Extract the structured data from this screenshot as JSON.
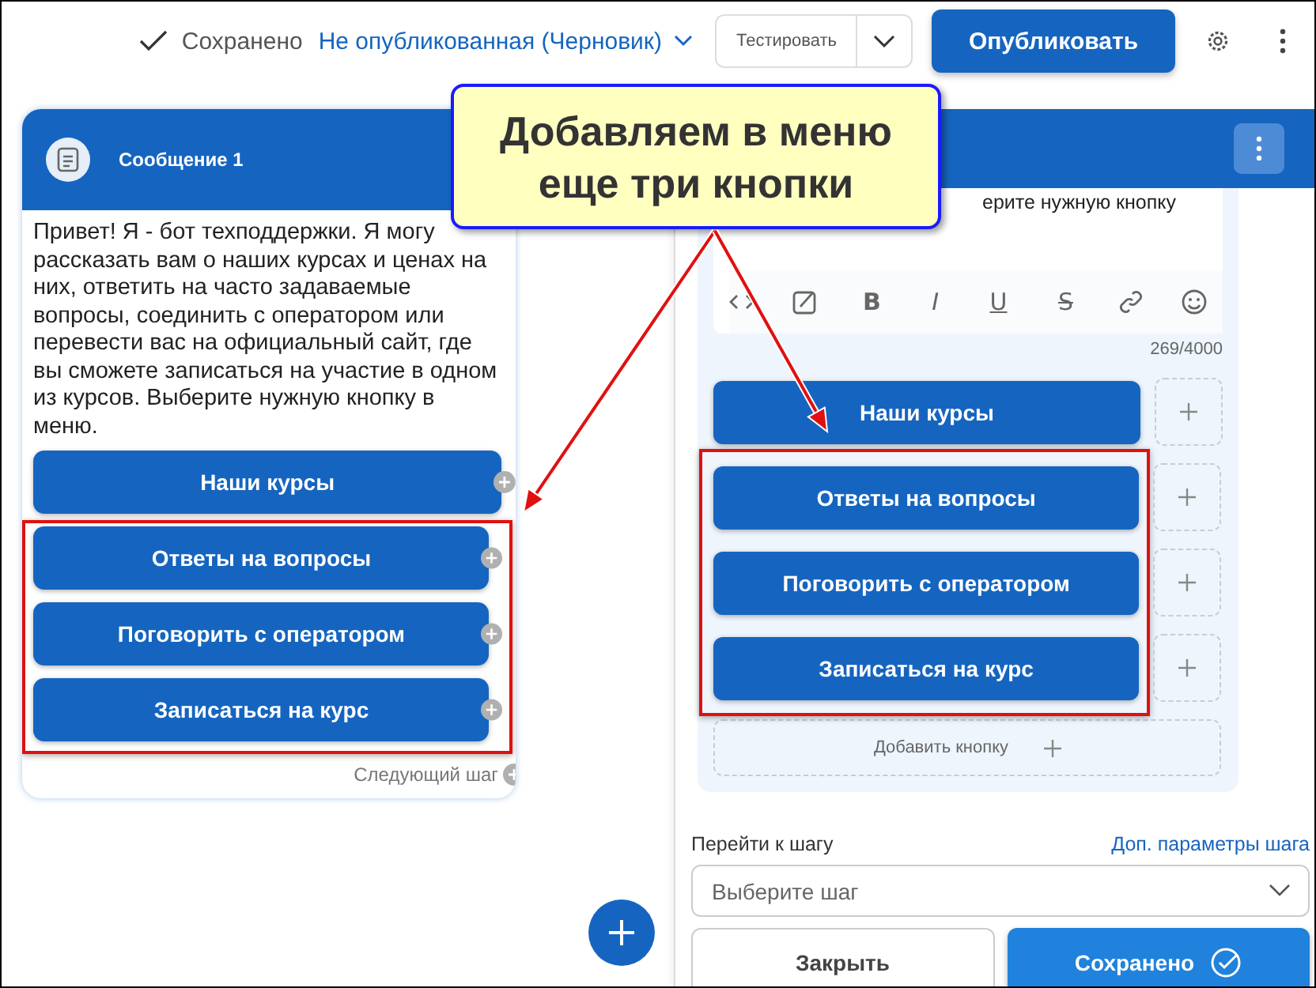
{
  "toolbar": {
    "save_status": "Сохранено",
    "publish_state": "Не опубликованная (Черновик)",
    "test_button": "Тестировать",
    "publish_button": "Опубликовать"
  },
  "message_card": {
    "title": "Сообщение 1",
    "text": "Привет! Я - бот техподдержки. Я могу рассказать вам о наших курсах и ценах на них, ответить на часто задаваемые вопросы, соединить с оператором или перевести вас на официальный сайт, где вы сможете записаться на участие в одном из курсов. Выберите нужную кнопку в меню.",
    "next_step": "Следующий шаг",
    "buttons": [
      {
        "label": "Наши курсы",
        "highlighted": false
      },
      {
        "label": "Ответы на вопросы",
        "highlighted": true
      },
      {
        "label": "Поговорить с оператором",
        "highlighted": true
      },
      {
        "label": "Записаться на курс",
        "highlighted": true
      }
    ]
  },
  "editor": {
    "text_visible": "ерите нужную кнопку",
    "format_labels": [
      "B",
      "I",
      "U",
      "S"
    ],
    "char_count": "269/4000",
    "buttons": [
      {
        "label": "Наши курсы",
        "highlighted": false
      },
      {
        "label": "Ответы на вопросы",
        "highlighted": true
      },
      {
        "label": "Поговорить с оператором",
        "highlighted": true
      },
      {
        "label": "Записаться на курс",
        "highlighted": true
      }
    ],
    "add_button": "Добавить кнопку",
    "goto_label": "Перейти к шагу",
    "more_link": "Доп. параметры шага",
    "step_select": {
      "placeholder": "Выберите шаг"
    },
    "close_button": "Закрыть",
    "save_button": "Сохранено"
  },
  "annotation": {
    "text": "Добавляем в меню\nеще три кнопки"
  }
}
